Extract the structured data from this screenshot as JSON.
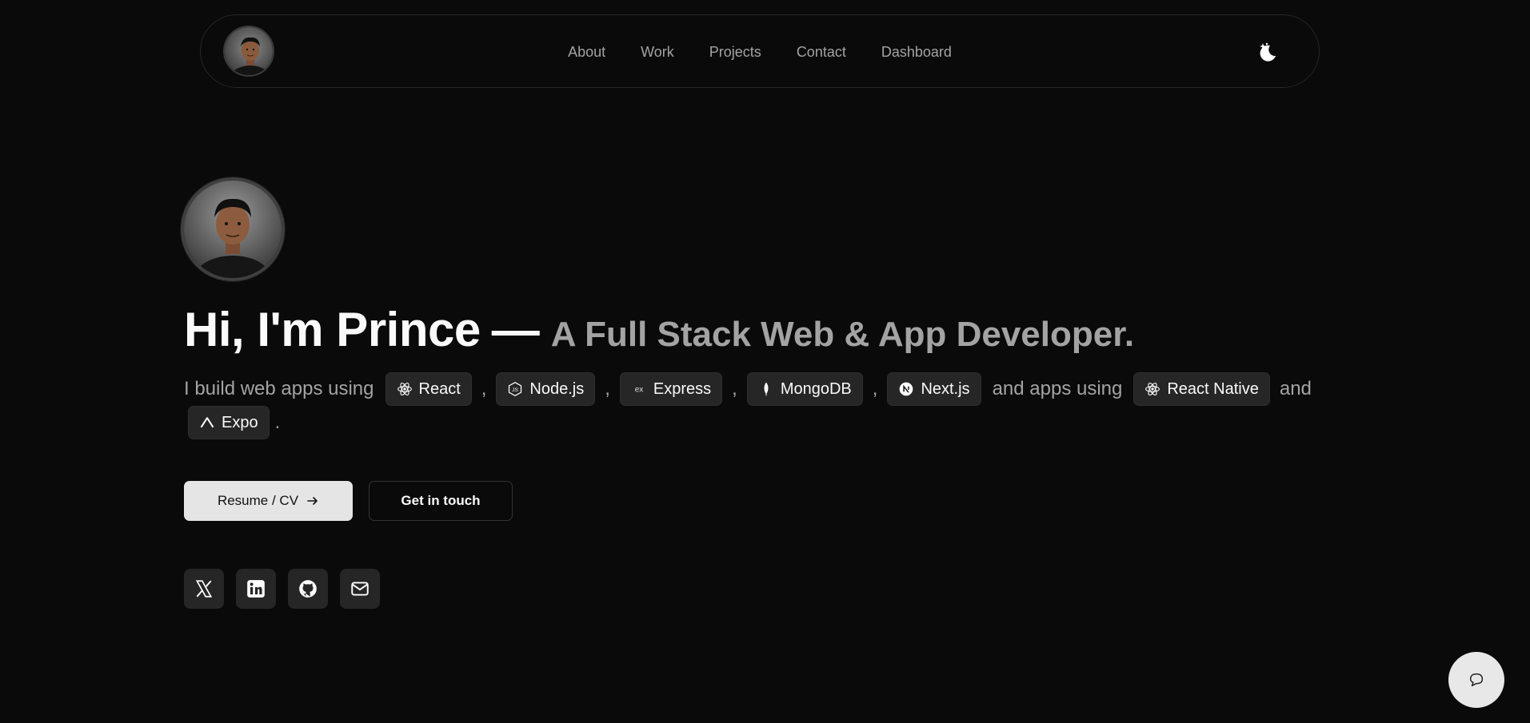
{
  "nav": {
    "links": [
      {
        "label": "About"
      },
      {
        "label": "Work"
      },
      {
        "label": "Projects"
      },
      {
        "label": "Contact"
      },
      {
        "label": "Dashboard"
      }
    ],
    "theme_icon": "moon-stars-icon"
  },
  "hero": {
    "name": "Hi, I'm Prince",
    "dash": "—",
    "role": "A Full Stack Web & App Developer.",
    "intro_prefix": "I build web apps using",
    "intro_middle": "and apps using",
    "intro_and": "and",
    "period": ".",
    "comma": ",",
    "web_tech": [
      {
        "label": "React",
        "icon": "react-icon"
      },
      {
        "label": "Node.js",
        "icon": "nodejs-icon"
      },
      {
        "label": "Express",
        "icon": "express-icon"
      },
      {
        "label": "MongoDB",
        "icon": "mongodb-icon"
      },
      {
        "label": "Next.js",
        "icon": "nextjs-icon"
      }
    ],
    "app_tech": [
      {
        "label": "React Native",
        "icon": "react-icon"
      },
      {
        "label": "Expo",
        "icon": "expo-icon"
      }
    ]
  },
  "buttons": {
    "resume": "Resume / CV",
    "contact": "Get in touch"
  },
  "socials": [
    {
      "icon": "x-twitter-icon"
    },
    {
      "icon": "linkedin-icon"
    },
    {
      "icon": "github-icon"
    },
    {
      "icon": "mail-icon"
    }
  ],
  "colors": {
    "background": "#0a0a0a",
    "muted_text": "#a3a3a3",
    "chip_bg": "#262626",
    "primary_button": "#e5e5e5"
  }
}
